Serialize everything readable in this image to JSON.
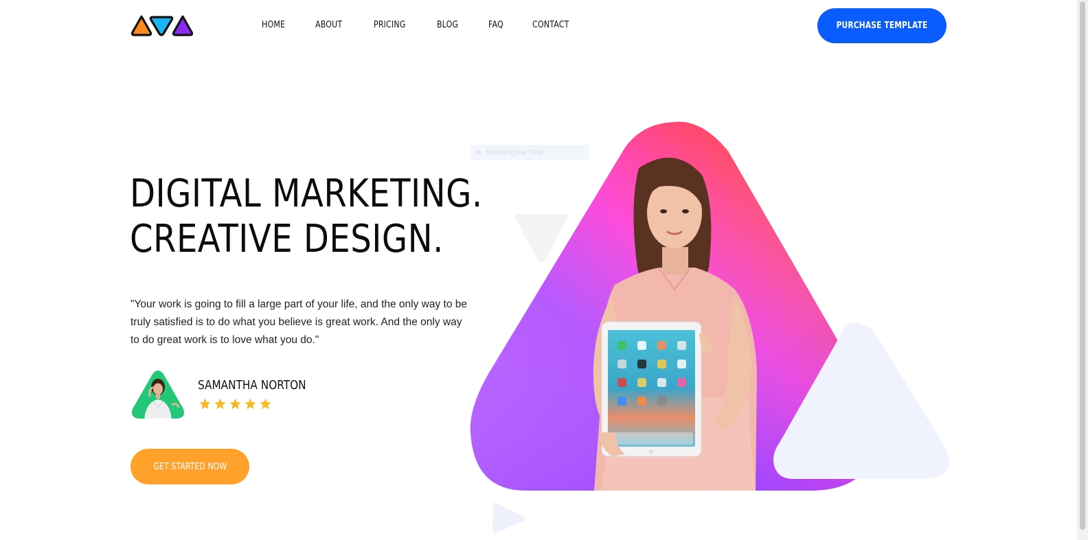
{
  "header": {
    "logo_name": "triangles-logo",
    "nav": [
      "HOME",
      "ABOUT",
      "PRICING",
      "BLOG",
      "FAQ",
      "CONTACT"
    ],
    "purchase_label": "PURCHASE TEMPLATE"
  },
  "hero": {
    "headline_line1": "DIGITAL MARKETING.",
    "headline_line2": "CREATIVE DESIGN.",
    "quote": "\"Your work is going to fill a large part of your life, and the only way to be truly satisfied is to do what you believe is great work. And the only way to do great work is to love what you do.\"",
    "cta_label": "GET STARTED NOW",
    "snip_label": "Rectangular Snip"
  },
  "testimonial": {
    "name": "SAMANTHA NORTON",
    "rating": 5
  },
  "colors": {
    "primary_blue": "#0a5cff",
    "cta_orange": "#ffa12b",
    "avatar_green": "#22c777",
    "star_yellow": "#f7b924",
    "logo_orange": "#ff8a1c",
    "logo_blue": "#1ab4f0",
    "logo_purple": "#8a2cf0"
  }
}
